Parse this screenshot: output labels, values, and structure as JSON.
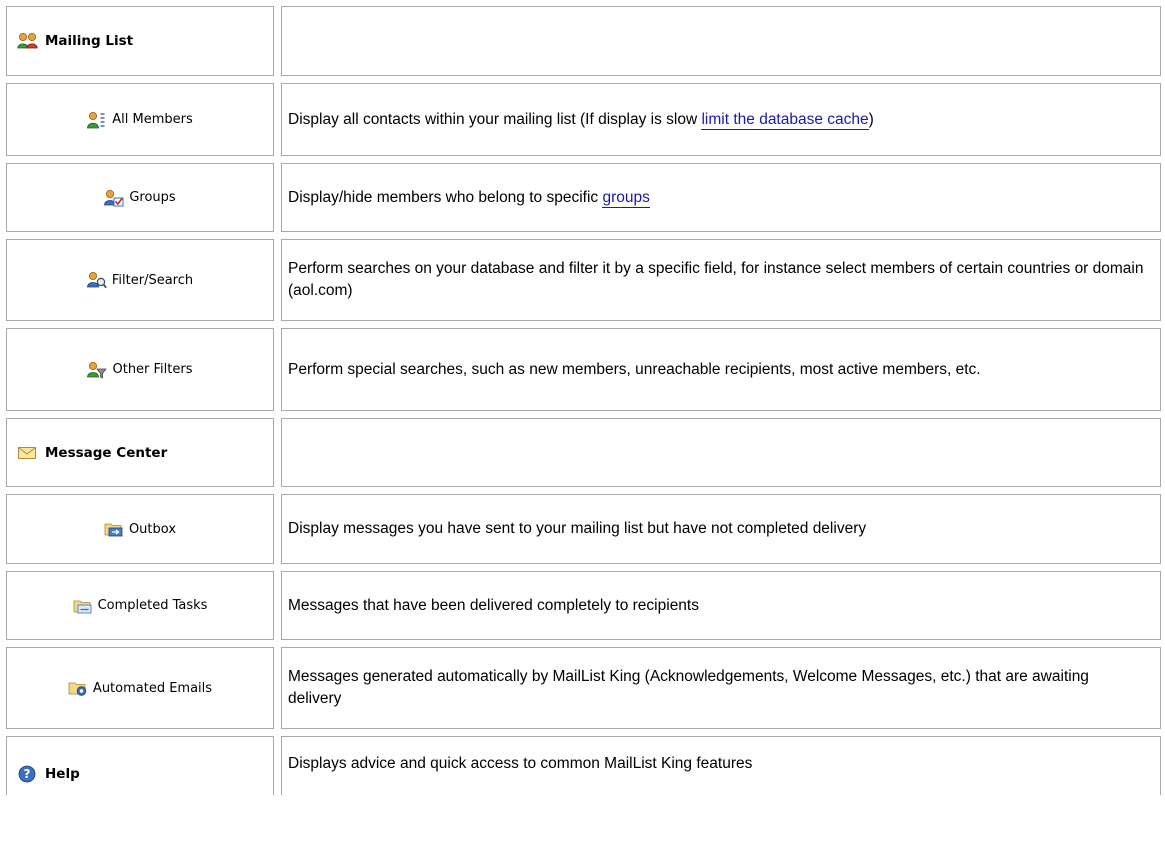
{
  "mailing_list": {
    "title": "Mailing List",
    "icon": "users-icon",
    "items": [
      {
        "label": "All Members",
        "icon": "members-list-icon",
        "desc_before": "Display all contacts within your mailing list (If display is slow ",
        "link": "limit the database cache",
        "desc_after": ")"
      },
      {
        "label": "Groups",
        "icon": "groups-icon",
        "desc_before": "Display/hide members who belong to specific ",
        "link": "groups",
        "desc_after": ""
      },
      {
        "label": "Filter/Search",
        "icon": "search-user-icon",
        "desc": "Perform searches on your database and filter it by a specific field, for instance select members of certain countries or domain (aol.com)"
      },
      {
        "label": "Other Filters",
        "icon": "filter-user-icon",
        "desc": "Perform special searches, such as new members, unreachable recipients, most active members, etc."
      }
    ]
  },
  "message_center": {
    "title": "Message Center",
    "icon": "envelope-icon",
    "items": [
      {
        "label": "Outbox",
        "icon": "outbox-folder-icon",
        "desc": "Display messages you have sent to your mailing list but have not completed delivery"
      },
      {
        "label": "Completed Tasks",
        "icon": "completed-folder-icon",
        "desc": "Messages that have been delivered completely to recipients"
      },
      {
        "label": "Automated Emails",
        "icon": "automated-folder-icon",
        "desc": "Messages generated automatically by MailList King (Acknowledgements, Welcome Messages, etc.) that are awaiting delivery"
      }
    ]
  },
  "help": {
    "title": "Help",
    "icon": "help-icon",
    "desc": "Displays advice and quick access to common MailList King features"
  },
  "colors": {
    "border": "#a9a9a9",
    "link": "#1a1aa6"
  }
}
